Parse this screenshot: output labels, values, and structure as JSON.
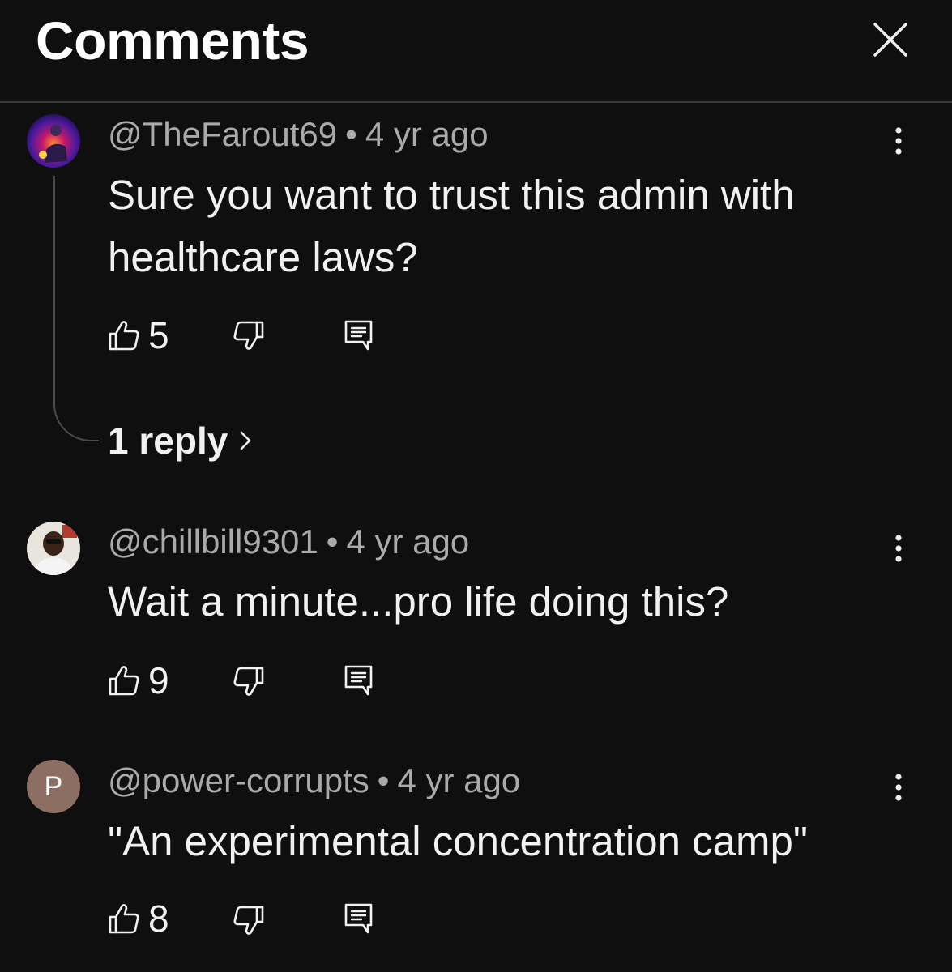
{
  "header": {
    "title": "Comments",
    "close_icon": "close-icon"
  },
  "comments": [
    {
      "author": "@TheFarout69",
      "time": "4 yr ago",
      "text": "Sure you want to trust this admin with healthcare laws?",
      "likes": "5",
      "replies_label": "1 reply"
    },
    {
      "author": "@chillbill9301",
      "time": "4 yr ago",
      "text": "Wait a minute...pro life doing this?",
      "likes": "9"
    },
    {
      "author": "@power-corrupts",
      "avatar_letter": "P",
      "time": "4 yr ago",
      "text": "\"An experimental concentration camp\"",
      "likes": "8"
    }
  ],
  "separator": "•",
  "icons": [
    "thumbs-up-icon",
    "thumbs-down-icon",
    "reply-icon",
    "more-vert-icon",
    "chevron-right-icon"
  ],
  "colors": {
    "background": "#0f0f0f",
    "text": "#f1f1f1",
    "meta": "#aaaaaa",
    "avatar_p": "#8d6e63"
  }
}
